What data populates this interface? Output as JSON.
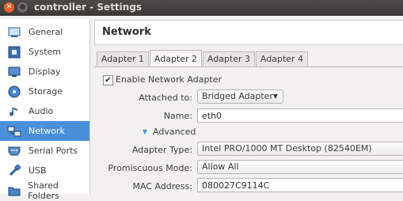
{
  "window": {
    "title": "controller - Settings"
  },
  "sidebar": {
    "items": [
      {
        "label": "General",
        "icon": "general-icon"
      },
      {
        "label": "System",
        "icon": "system-icon"
      },
      {
        "label": "Display",
        "icon": "display-icon"
      },
      {
        "label": "Storage",
        "icon": "storage-icon"
      },
      {
        "label": "Audio",
        "icon": "audio-icon"
      },
      {
        "label": "Network",
        "icon": "network-icon",
        "active": true
      },
      {
        "label": "Serial Ports",
        "icon": "serial-ports-icon"
      },
      {
        "label": "USB",
        "icon": "usb-icon"
      },
      {
        "label": "Shared Folders",
        "icon": "shared-folders-icon"
      }
    ]
  },
  "header": {
    "title": "Network"
  },
  "tabs": [
    {
      "label": "Adapter 1"
    },
    {
      "label": "Adapter 2",
      "active": true
    },
    {
      "label": "Adapter 3"
    },
    {
      "label": "Adapter 4"
    }
  ],
  "adapter": {
    "enable_label": "Enable Network Adapter",
    "enabled": true,
    "attached_label": "Attached to:",
    "attached_value": "Bridged Adapter",
    "name_label": "Name:",
    "name_value": "eth0",
    "advanced_label": "Advanced",
    "type_label": "Adapter Type:",
    "type_value": "Intel PRO/1000 MT Desktop (82540EM)",
    "promisc_label": "Promiscuous Mode:",
    "promisc_value": "Allow All",
    "mac_label": "MAC Address:",
    "mac_value": "080027C9114C"
  },
  "colors": {
    "accent": "#4a90d9",
    "titlebar": "#3c3b37",
    "close": "#e8612c"
  }
}
